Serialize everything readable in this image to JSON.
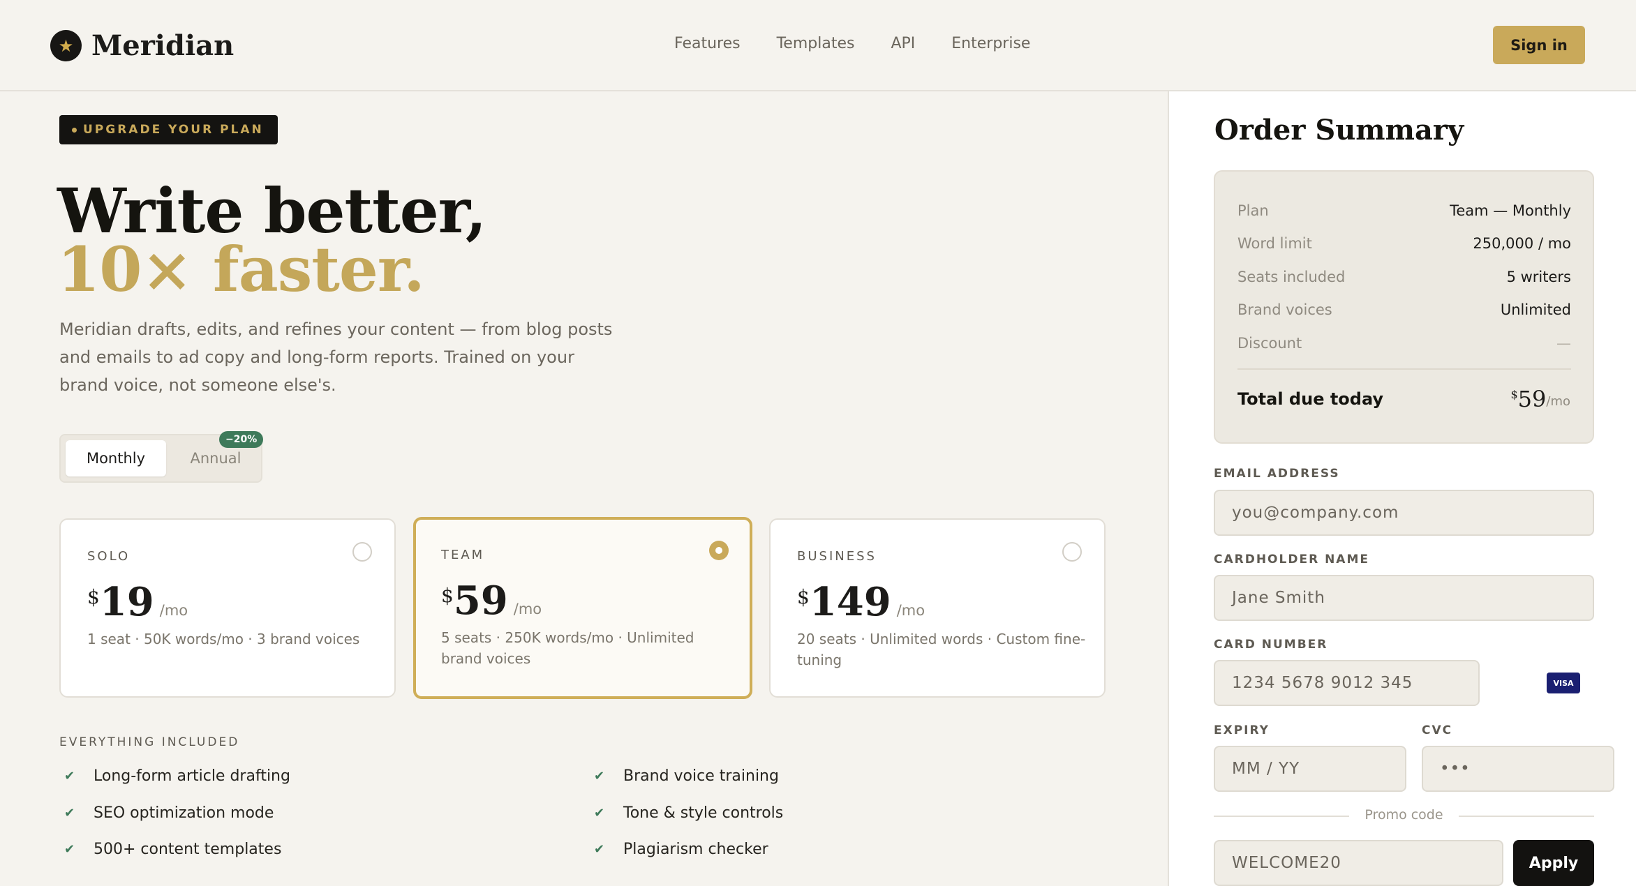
{
  "header": {
    "logo_mark": "★",
    "logo_text": "Meridian",
    "nav": [
      "Features",
      "Templates",
      "API",
      "Enterprise"
    ],
    "signin_label": "Sign in"
  },
  "hero": {
    "eyebrow": "UPGRADE YOUR PLAN",
    "headline_line1": "Write better,",
    "headline_line2": "10× faster.",
    "intro": "Meridian drafts, edits, and refines your content — from blog posts and emails to ad copy and long-form reports. Trained on your brand voice, not someone else's."
  },
  "billing_toggle": {
    "monthly_label": "Monthly",
    "annual_label": "Annual",
    "annual_badge": "−20%",
    "selected": "Monthly"
  },
  "plans": [
    {
      "name": "SOLO",
      "currency": "$",
      "price": "19",
      "period": "/mo",
      "description": "1 seat · 50K words/mo · 3 brand voices",
      "selected": false
    },
    {
      "name": "TEAM",
      "currency": "$",
      "price": "59",
      "period": "/mo",
      "description": "5 seats · 250K words/mo · Unlimited brand voices",
      "selected": true
    },
    {
      "name": "BUSINESS",
      "currency": "$",
      "price": "149",
      "period": "/mo",
      "description": "20 seats · Unlimited words · Custom fine-tuning",
      "selected": false
    }
  ],
  "included": {
    "title": "EVERYTHING INCLUDED",
    "features": [
      "Long-form article drafting",
      "Brand voice training",
      "SEO optimization mode",
      "Tone & style controls",
      "500+ content templates",
      "Plagiarism checker"
    ]
  },
  "order_summary": {
    "title": "Order Summary",
    "rows": [
      {
        "label": "Plan",
        "value": "Team — Monthly"
      },
      {
        "label": "Word limit",
        "value": "250,000 / mo"
      },
      {
        "label": "Seats included",
        "value": "5 writers"
      },
      {
        "label": "Brand voices",
        "value": "Unlimited"
      },
      {
        "label": "Discount",
        "value": "—"
      }
    ],
    "total_label": "Total due today",
    "total_currency": "$",
    "total_amount": "59",
    "total_period": "/mo"
  },
  "form": {
    "email_label": "EMAIL ADDRESS",
    "email_placeholder": "you@company.com",
    "name_label": "CARDHOLDER NAME",
    "name_placeholder": "Jane Smith",
    "card_label": "CARD NUMBER",
    "card_placeholder": "1234  5678  9012  345",
    "card_brand": "VISA",
    "expiry_label": "EXPIRY",
    "expiry_placeholder": "MM / YY",
    "cvc_label": "CVC",
    "cvc_placeholder": "•••",
    "promo_label": "Promo code",
    "promo_value": "WELCOME20",
    "apply_label": "Apply"
  },
  "colors": {
    "accent_gold": "#c9a95a",
    "dark": "#141311",
    "success_green": "#3e7a5a",
    "card_brand_blue": "#1a1f71"
  }
}
